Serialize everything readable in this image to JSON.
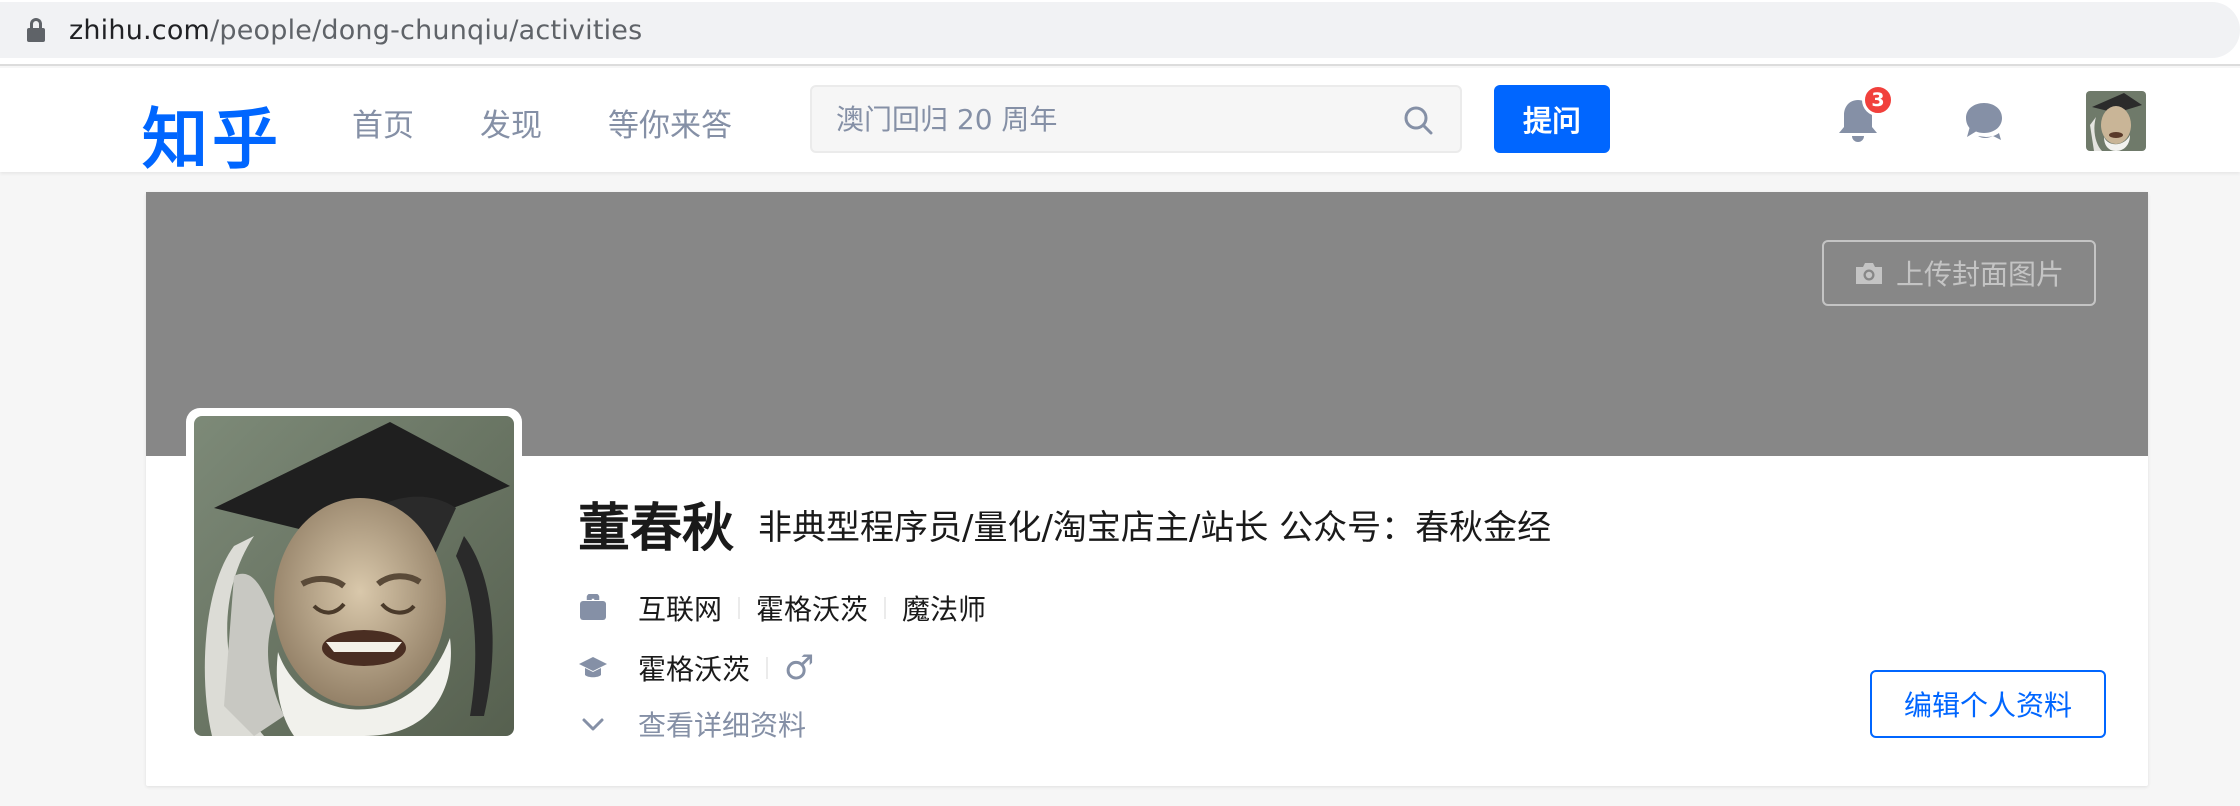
{
  "browser": {
    "url_host": "zhihu.com",
    "url_path": "/people/dong-chunqiu/activities"
  },
  "header": {
    "logo": "知乎",
    "nav": [
      "首页",
      "发现",
      "等你来答"
    ],
    "search_placeholder": "澳门回归 20 周年",
    "ask_label": "提问",
    "notification_count": "3"
  },
  "profile": {
    "upload_cover_label": "上传封面图片",
    "name": "董春秋",
    "headline": "非典型程序员/量化/淘宝店主/站长 公众号：春秋金经",
    "work": [
      "互联网",
      "霍格沃茨",
      "魔法师"
    ],
    "education": "霍格沃茨",
    "gender_symbol": "♂",
    "detail_label": "查看详细资料",
    "edit_label": "编辑个人资料"
  },
  "colors": {
    "brand": "#0066ff",
    "badge": "#f1403c",
    "cover": "#878787",
    "muted": "#8590a6"
  }
}
